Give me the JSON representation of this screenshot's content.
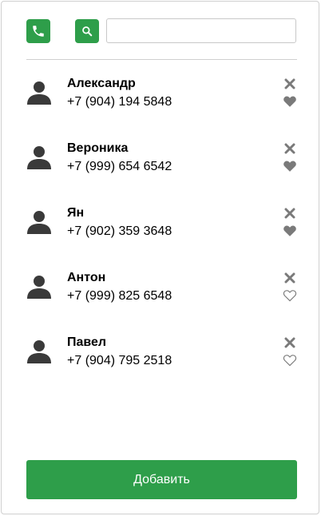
{
  "colors": {
    "accent": "#2e9e4a",
    "icon_gray": "#7a7a7a",
    "avatar": "#3a3a3a"
  },
  "toolbar": {
    "phone_icon": "phone-icon",
    "search_icon": "search-icon",
    "search_value": ""
  },
  "contacts": [
    {
      "name": "Александр",
      "phone": "+7 (904) 194 5848",
      "favorite": true
    },
    {
      "name": "Вероника",
      "phone": "+7 (999) 654 6542",
      "favorite": true
    },
    {
      "name": "Ян",
      "phone": "+7 (902) 359 3648",
      "favorite": true
    },
    {
      "name": "Антон",
      "phone": "+7 (999) 825 6548",
      "favorite": false
    },
    {
      "name": "Павел",
      "phone": "+7 (904) 795 2518",
      "favorite": false
    }
  ],
  "add_button": {
    "label": "Добавить"
  }
}
